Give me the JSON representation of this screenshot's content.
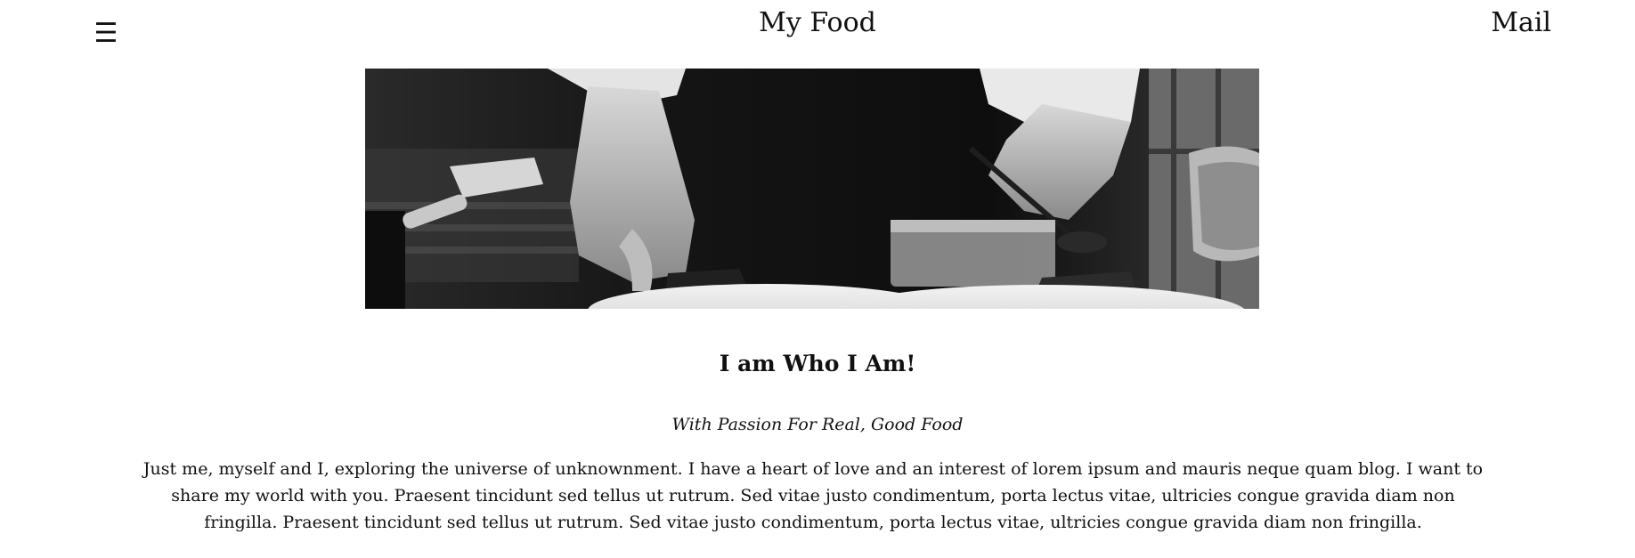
{
  "header": {
    "menu_icon": "☰",
    "site_title": "My Food",
    "mail_label": "Mail"
  },
  "hero": {
    "image_label": "chefs-plating-food-photo"
  },
  "about": {
    "heading": "I am Who I Am!",
    "subheading": "With Passion For Real, Good Food",
    "body": "Just me, myself and I, exploring the universe of unknownment. I have a heart of love and an interest of lorem ipsum and mauris neque quam blog. I want to share my world with you. Praesent tincidunt sed tellus ut rutrum. Sed vitae justo condimentum, porta lectus vitae, ultricies congue gravida diam non fringilla. Praesent tincidunt sed tellus ut rutrum. Sed vitae justo condimentum, porta lectus vitae, ultricies congue gravida diam non fringilla."
  },
  "colors": {
    "text": "#111111",
    "background": "#ffffff"
  }
}
